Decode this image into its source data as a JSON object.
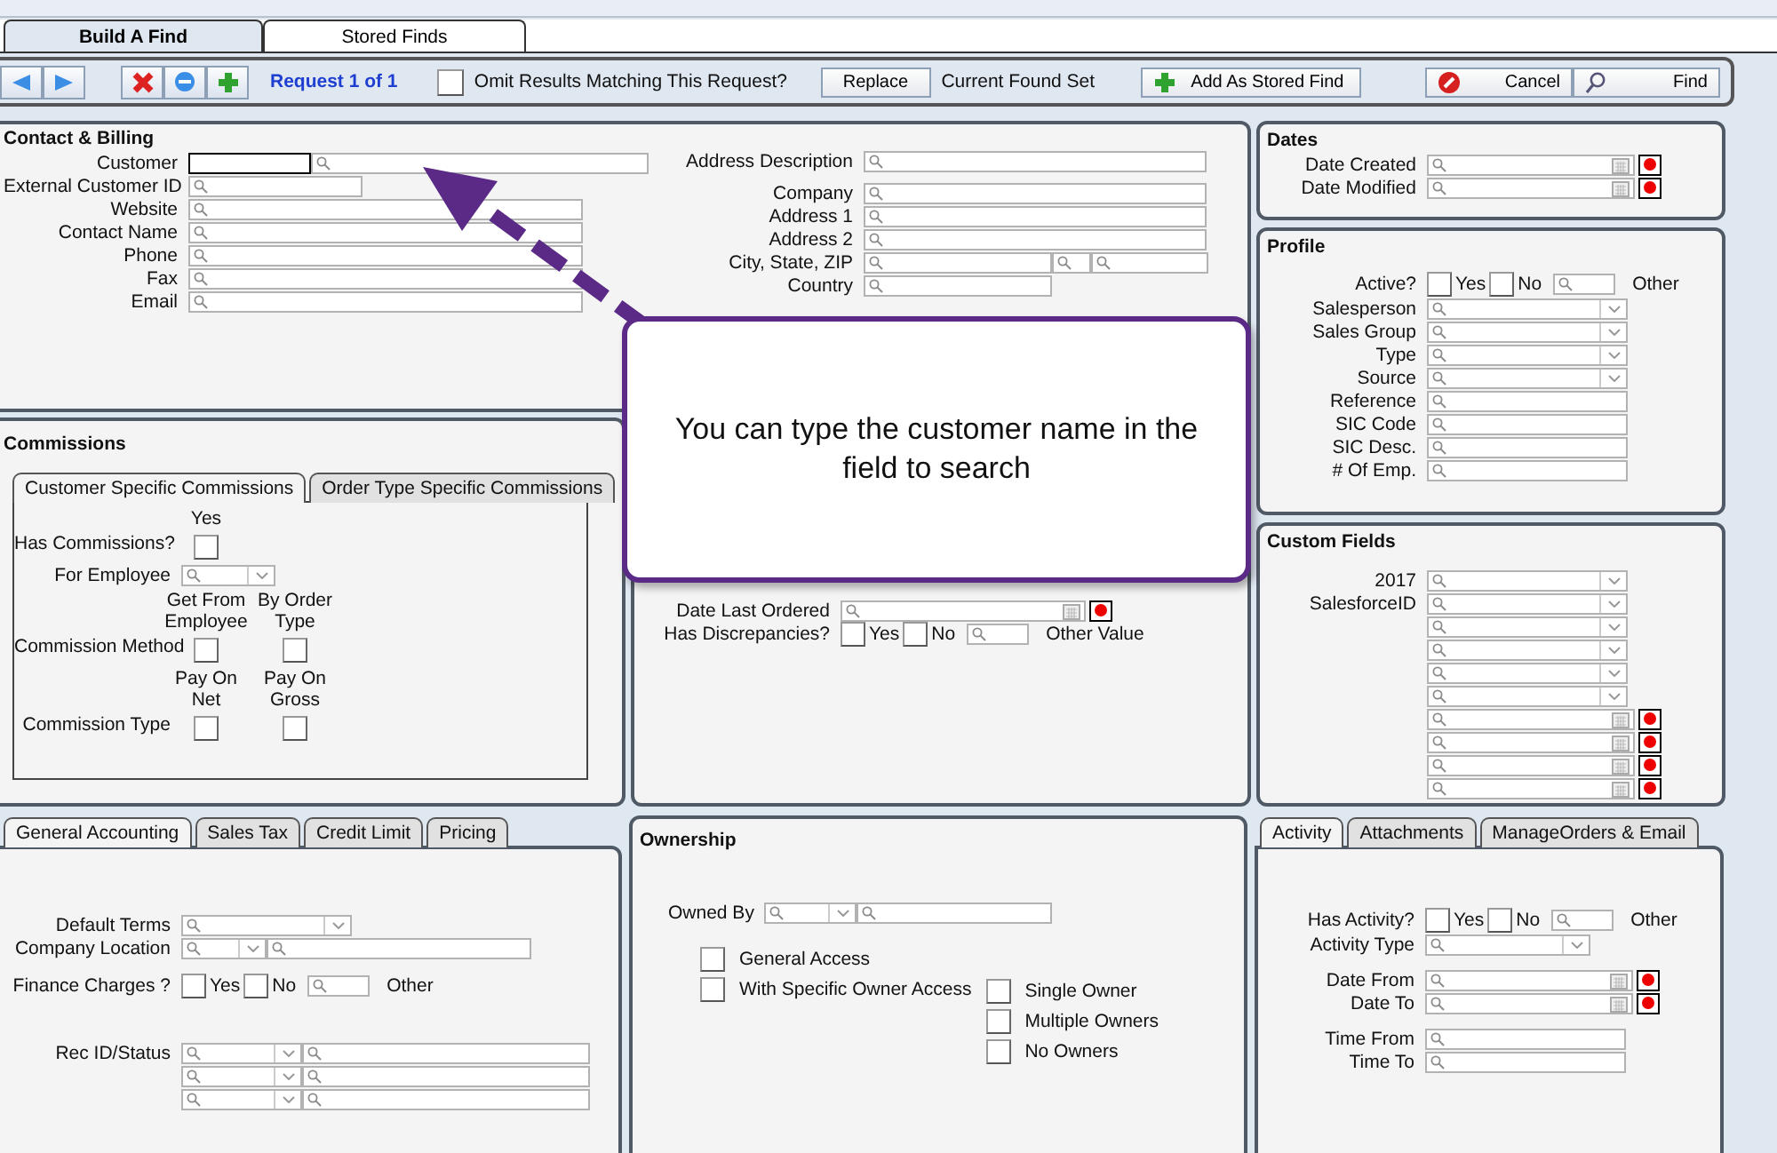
{
  "top_tabs": [
    {
      "label": "Build A Find",
      "selected": true
    },
    {
      "label": "Stored Finds",
      "selected": false
    }
  ],
  "toolbar": {
    "request_label": "Request 1 of 1",
    "omit": {
      "label": "Omit Results Matching This Request?",
      "checked": false
    },
    "replace_button": "Replace",
    "found_set_label": "Current Found Set",
    "add_stored_button": "Add As Stored Find",
    "cancel_button": "Cancel",
    "find_button": "Find"
  },
  "contact_billing": {
    "title": "Contact & Billing",
    "left_fields": [
      {
        "kind": "split",
        "label": "Customer"
      },
      {
        "kind": "short",
        "label": "External Customer ID"
      },
      {
        "kind": "text",
        "label": "Website"
      },
      {
        "kind": "text",
        "label": "Contact Name"
      },
      {
        "kind": "text",
        "label": "Phone"
      },
      {
        "kind": "text",
        "label": "Fax"
      },
      {
        "kind": "text",
        "label": "Email"
      }
    ],
    "right_fields": [
      {
        "kind": "text",
        "label": "Address Description"
      },
      {
        "kind": "text",
        "label": "Company"
      },
      {
        "kind": "text",
        "label": "Address 1"
      },
      {
        "kind": "text",
        "label": "Address 2"
      },
      {
        "kind": "triple",
        "label": "City, State, ZIP"
      },
      {
        "kind": "short",
        "label": "Country"
      }
    ]
  },
  "commissions": {
    "title": "Commissions",
    "tabs": [
      {
        "label": "Customer Specific Commissions",
        "selected": true
      },
      {
        "label": "Order Type Specific Commissions",
        "selected": false
      }
    ],
    "rows": [
      {
        "kind": "checks",
        "label": "Has Commissions?",
        "options": [
          {
            "label": "Yes",
            "checked": false
          }
        ]
      },
      {
        "kind": "dropdown",
        "label": "For Employee"
      },
      {
        "kind": "checks",
        "label": "Commission Method",
        "options": [
          {
            "label": "Get From Employee",
            "checked": false
          },
          {
            "label": "By Order Type",
            "checked": false
          }
        ]
      },
      {
        "kind": "checks",
        "label": "Commission Type",
        "options": [
          {
            "label": "Pay On Net",
            "checked": false
          },
          {
            "label": "Pay On Gross",
            "checked": false
          }
        ]
      }
    ]
  },
  "order_info": {
    "fields": [
      {
        "kind": "date",
        "label": "Date Last Ordered"
      },
      {
        "kind": "yesno",
        "label": "Has Discrepancies?",
        "options": [
          {
            "label": "Yes",
            "checked": false
          },
          {
            "label": "No",
            "checked": false
          }
        ],
        "other_label": "Other Value"
      }
    ]
  },
  "dates": {
    "title": "Dates",
    "fields": [
      {
        "kind": "date",
        "label": "Date Created"
      },
      {
        "kind": "date",
        "label": "Date Modified"
      }
    ]
  },
  "profile": {
    "title": "Profile",
    "fields": [
      {
        "kind": "yesno",
        "label": "Active?",
        "options": [
          {
            "label": "Yes",
            "checked": false
          },
          {
            "label": "No",
            "checked": false
          }
        ],
        "other_label": "Other"
      },
      {
        "kind": "dropdown",
        "label": "Salesperson"
      },
      {
        "kind": "dropdown",
        "label": "Sales Group"
      },
      {
        "kind": "dropdown",
        "label": "Type"
      },
      {
        "kind": "dropdown",
        "label": "Source"
      },
      {
        "kind": "text",
        "label": "Reference"
      },
      {
        "kind": "text",
        "label": "SIC Code"
      },
      {
        "kind": "text",
        "label": "SIC Desc."
      },
      {
        "kind": "text",
        "label": "# Of Emp."
      }
    ]
  },
  "custom_fields": {
    "title": "Custom Fields",
    "fields": [
      {
        "kind": "dropdown",
        "label": "2017"
      },
      {
        "kind": "dropdown",
        "label": "SalesforceID"
      },
      {
        "kind": "dropdown"
      },
      {
        "kind": "dropdown"
      },
      {
        "kind": "dropdown"
      },
      {
        "kind": "dropdown"
      },
      {
        "kind": "date"
      },
      {
        "kind": "date"
      },
      {
        "kind": "date"
      },
      {
        "kind": "date"
      }
    ]
  },
  "accounting": {
    "tabs": [
      {
        "label": "General Accounting",
        "selected": true
      },
      {
        "label": "Sales Tax",
        "selected": false
      },
      {
        "label": "Credit Limit",
        "selected": false
      },
      {
        "label": "Pricing",
        "selected": false
      }
    ],
    "fields": [
      {
        "kind": "dropdown",
        "label": "Default Terms"
      },
      {
        "kind": "combo",
        "label": "Company Location"
      },
      {
        "kind": "yesno",
        "label": "Finance Charges ?",
        "options": [
          {
            "label": "Yes",
            "checked": false
          },
          {
            "label": "No",
            "checked": false
          }
        ],
        "other_label": "Other"
      },
      {
        "kind": "status",
        "label": "Rec ID/Status"
      },
      {
        "kind": "status"
      },
      {
        "kind": "status"
      }
    ]
  },
  "ownership": {
    "title": "Ownership",
    "owned_by": {
      "kind": "combo",
      "label": "Owned By"
    },
    "access_options": [
      {
        "label": "General Access",
        "checked": false
      },
      {
        "label": "With Specific Owner Access",
        "checked": false
      }
    ],
    "owner_options": [
      {
        "label": "Single Owner",
        "checked": false
      },
      {
        "label": "Multiple Owners",
        "checked": false
      },
      {
        "label": "No Owners",
        "checked": false
      }
    ]
  },
  "activity": {
    "tabs": [
      {
        "label": "Activity",
        "selected": true
      },
      {
        "label": "Attachments",
        "selected": false
      },
      {
        "label": "ManageOrders & Email",
        "selected": false
      }
    ],
    "fields": [
      {
        "kind": "yesno",
        "label": "Has Activity?",
        "options": [
          {
            "label": "Yes",
            "checked": false
          },
          {
            "label": "No",
            "checked": false
          }
        ],
        "other_label": "Other"
      },
      {
        "kind": "dropdown",
        "label": "Activity Type"
      },
      {
        "kind": "date",
        "label": "Date From"
      },
      {
        "kind": "date",
        "label": "Date To"
      },
      {
        "kind": "text",
        "label": "Time From"
      },
      {
        "kind": "text",
        "label": "Time To"
      }
    ]
  },
  "callout": {
    "text": "You can type the customer name in the field to search"
  }
}
